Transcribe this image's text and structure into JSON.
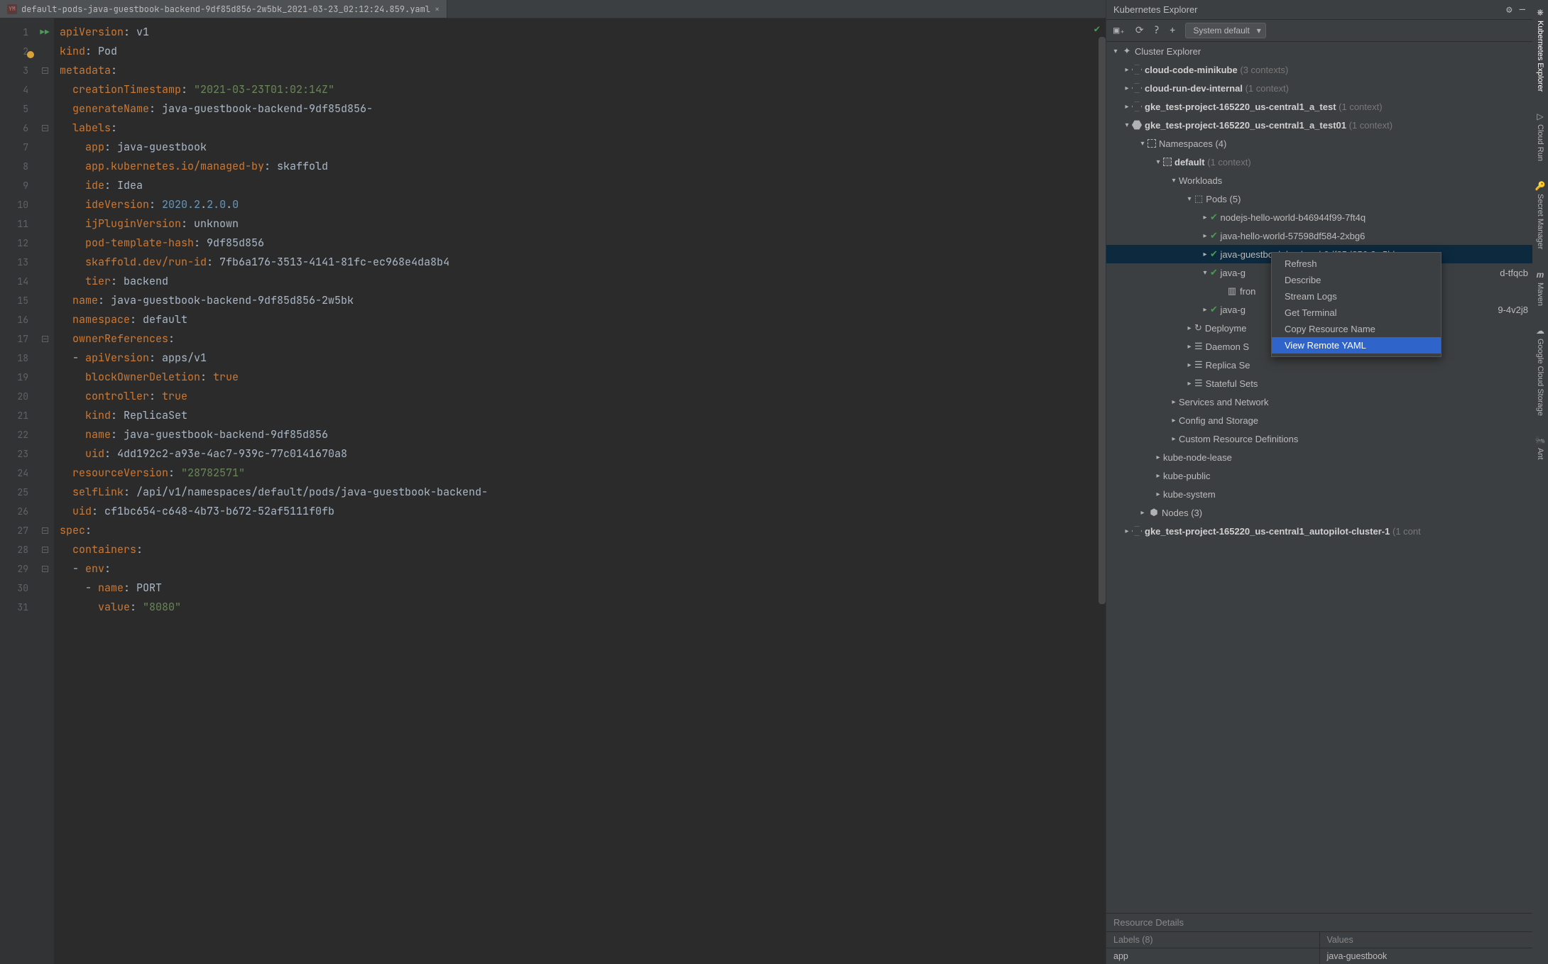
{
  "tab": {
    "filename": "default-pods-java-guestbook-backend-9df85d856-2w5bk_2021-03-23_02:12:24.859.yaml"
  },
  "code_lines": [
    [
      [
        "k",
        "apiVersion"
      ],
      [
        "p",
        ": "
      ],
      [
        "p",
        "v1"
      ]
    ],
    [
      [
        "k",
        "kind"
      ],
      [
        "p",
        ": "
      ],
      [
        "p",
        "Pod"
      ]
    ],
    [
      [
        "k",
        "metadata"
      ],
      [
        "p",
        ":"
      ]
    ],
    [
      [
        "p",
        "  "
      ],
      [
        "k",
        "creationTimestamp"
      ],
      [
        "p",
        ": "
      ],
      [
        "s",
        "\"2021-03-23T01:02:14Z\""
      ]
    ],
    [
      [
        "p",
        "  "
      ],
      [
        "k",
        "generateName"
      ],
      [
        "p",
        ": "
      ],
      [
        "p",
        "java-guestbook-backend-9df85d856-"
      ]
    ],
    [
      [
        "p",
        "  "
      ],
      [
        "k",
        "labels"
      ],
      [
        "p",
        ":"
      ]
    ],
    [
      [
        "p",
        "    "
      ],
      [
        "k",
        "app"
      ],
      [
        "p",
        ": "
      ],
      [
        "p",
        "java-guestbook"
      ]
    ],
    [
      [
        "p",
        "    "
      ],
      [
        "k",
        "app.kubernetes.io/managed-by"
      ],
      [
        "p",
        ": "
      ],
      [
        "p",
        "skaffold"
      ]
    ],
    [
      [
        "p",
        "    "
      ],
      [
        "k",
        "ide"
      ],
      [
        "p",
        ": "
      ],
      [
        "p",
        "Idea"
      ]
    ],
    [
      [
        "p",
        "    "
      ],
      [
        "k",
        "ideVersion"
      ],
      [
        "p",
        ": "
      ],
      [
        "n",
        "2020.2"
      ],
      [
        "p",
        "."
      ],
      [
        "n",
        "2.0"
      ],
      [
        "p",
        "."
      ],
      [
        "n",
        "0"
      ]
    ],
    [
      [
        "p",
        "    "
      ],
      [
        "k",
        "ijPluginVersion"
      ],
      [
        "p",
        ": "
      ],
      [
        "p",
        "unknown"
      ]
    ],
    [
      [
        "p",
        "    "
      ],
      [
        "k",
        "pod-template-hash"
      ],
      [
        "p",
        ": "
      ],
      [
        "p",
        "9df85d856"
      ]
    ],
    [
      [
        "p",
        "    "
      ],
      [
        "k",
        "skaffold.dev/run-id"
      ],
      [
        "p",
        ": "
      ],
      [
        "p",
        "7fb6a176-3513-4141-81fc-ec968e4da8b4"
      ]
    ],
    [
      [
        "p",
        "    "
      ],
      [
        "k",
        "tier"
      ],
      [
        "p",
        ": "
      ],
      [
        "p",
        "backend"
      ]
    ],
    [
      [
        "p",
        "  "
      ],
      [
        "k",
        "name"
      ],
      [
        "p",
        ": "
      ],
      [
        "p",
        "java-guestbook-backend-9df85d856-2w5bk"
      ]
    ],
    [
      [
        "p",
        "  "
      ],
      [
        "k",
        "namespace"
      ],
      [
        "p",
        ": "
      ],
      [
        "p",
        "default"
      ]
    ],
    [
      [
        "p",
        "  "
      ],
      [
        "k",
        "ownerReferences"
      ],
      [
        "p",
        ":"
      ]
    ],
    [
      [
        "p",
        "  - "
      ],
      [
        "k",
        "apiVersion"
      ],
      [
        "p",
        ": "
      ],
      [
        "p",
        "apps/v1"
      ]
    ],
    [
      [
        "p",
        "    "
      ],
      [
        "k",
        "blockOwnerDeletion"
      ],
      [
        "p",
        ": "
      ],
      [
        "k",
        "true"
      ]
    ],
    [
      [
        "p",
        "    "
      ],
      [
        "k",
        "controller"
      ],
      [
        "p",
        ": "
      ],
      [
        "k",
        "true"
      ]
    ],
    [
      [
        "p",
        "    "
      ],
      [
        "k",
        "kind"
      ],
      [
        "p",
        ": "
      ],
      [
        "p",
        "ReplicaSet"
      ]
    ],
    [
      [
        "p",
        "    "
      ],
      [
        "k",
        "name"
      ],
      [
        "p",
        ": "
      ],
      [
        "p",
        "java-guestbook-backend-9df85d856"
      ]
    ],
    [
      [
        "p",
        "    "
      ],
      [
        "k",
        "uid"
      ],
      [
        "p",
        ": "
      ],
      [
        "p",
        "4dd192c2-a93e-4ac7-939c-77c0141670a8"
      ]
    ],
    [
      [
        "p",
        "  "
      ],
      [
        "k",
        "resourceVersion"
      ],
      [
        "p",
        ": "
      ],
      [
        "s",
        "\"28782571\""
      ]
    ],
    [
      [
        "p",
        "  "
      ],
      [
        "k",
        "selfLink"
      ],
      [
        "p",
        ": "
      ],
      [
        "p",
        "/api/v1/namespaces/default/pods/java-guestbook-backend-"
      ]
    ],
    [
      [
        "p",
        "  "
      ],
      [
        "k",
        "uid"
      ],
      [
        "p",
        ": "
      ],
      [
        "p",
        "cf1bc654-c648-4b73-b672-52af5111f0fb"
      ]
    ],
    [
      [
        "k",
        "spec"
      ],
      [
        "p",
        ":"
      ]
    ],
    [
      [
        "p",
        "  "
      ],
      [
        "k",
        "containers"
      ],
      [
        "p",
        ":"
      ]
    ],
    [
      [
        "p",
        "  - "
      ],
      [
        "k",
        "env"
      ],
      [
        "p",
        ":"
      ]
    ],
    [
      [
        "p",
        "    - "
      ],
      [
        "k",
        "name"
      ],
      [
        "p",
        ": "
      ],
      [
        "p",
        "PORT"
      ]
    ],
    [
      [
        "p",
        "      "
      ],
      [
        "k",
        "value"
      ],
      [
        "p",
        ": "
      ],
      [
        "s",
        "\"8080\""
      ]
    ]
  ],
  "explorer": {
    "title": "Kubernetes Explorer",
    "system": "System default",
    "root": "Cluster Explorer",
    "clusters": [
      {
        "name": "cloud-code-minikube",
        "ctx": "(3 contexts)",
        "open": false
      },
      {
        "name": "cloud-run-dev-internal",
        "ctx": "(1 context)",
        "open": false
      },
      {
        "name": "gke_test-project-165220_us-central1_a_test",
        "ctx": "(1 context)",
        "open": false
      },
      {
        "name": "gke_test-project-165220_us-central1_a_test01",
        "ctx": "(1 context)",
        "open": true
      }
    ],
    "namespaces_label": "Namespaces (4)",
    "default_label": "default",
    "default_ctx": "(1 context)",
    "workloads": "Workloads",
    "pods": "Pods (5)",
    "pod_list": [
      "nodejs-hello-world-b46944f99-7ft4q",
      "java-hello-world-57598df584-2xbg6",
      "java-guestbook-backend-9df85d856-2w5bk",
      "java-guestbook-frontend-db44784d5d-tfqcb",
      "java-guestbook-mongodb-fb99f9c99-4v2j8"
    ],
    "pod3_vis": "java-g",
    "pod4_vis_a": "java-g",
    "pod4_vis_b": "d-tfqcb",
    "pod4_child": "fron",
    "pod5_vis_a": "java-g",
    "pod5_vis_b": "9-4v2j8",
    "deployments": "Deployme",
    "daemon": "Daemon S",
    "replica": "Replica Se",
    "stateful": "Stateful Sets",
    "services": "Services and Network",
    "config": "Config and Storage",
    "crd": "Custom Resource Definitions",
    "extras": [
      "kube-node-lease",
      "kube-public",
      "kube-system"
    ],
    "nodes": "Nodes (3)",
    "autopilot": "gke_test-project-165220_us-central1_autopilot-cluster-1",
    "autopilot_ctx": "(1 cont"
  },
  "ctx_menu": [
    "Refresh",
    "Describe",
    "Stream Logs",
    "Get Terminal",
    "Copy Resource Name",
    "View Remote YAML"
  ],
  "details": {
    "title": "Resource Details",
    "col1": "Labels (8)",
    "col2": "Values",
    "r1a": "app",
    "r1b": "java-guestbook"
  },
  "sidetabs": [
    "Kubernetes Explorer",
    "Cloud Run",
    "Secret Manager",
    "Maven",
    "Google Cloud Storage",
    "Ant"
  ]
}
